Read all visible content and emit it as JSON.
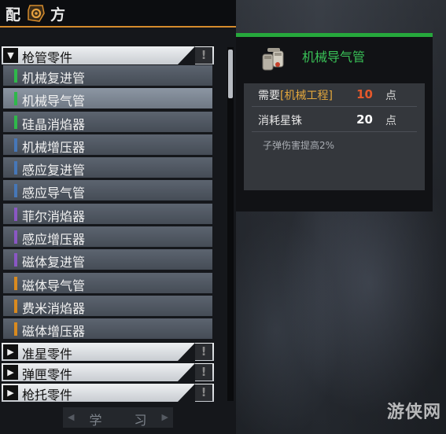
{
  "header": {
    "title_left": "配",
    "title_right": "方",
    "icon": "gear-hex-icon",
    "accent": "#d58b2c"
  },
  "categories": [
    {
      "label": "枪管零件",
      "expanded": true
    },
    {
      "label": "准星零件",
      "expanded": false
    },
    {
      "label": "弹匣零件",
      "expanded": false
    },
    {
      "label": "枪托零件",
      "expanded": false
    }
  ],
  "category_badge": "!",
  "items": [
    {
      "label": "机械复进管",
      "color": "#2fb84a"
    },
    {
      "label": "机械导气管",
      "color": "#2fb84a",
      "selected": true
    },
    {
      "label": "硅晶消焰器",
      "color": "#2fb84a"
    },
    {
      "label": "机械增压器",
      "color": "#4677b8"
    },
    {
      "label": "感应复进管",
      "color": "#4677b8"
    },
    {
      "label": "感应导气管",
      "color": "#4677b8"
    },
    {
      "label": "菲尔消焰器",
      "color": "#8a57c4"
    },
    {
      "label": "感应增压器",
      "color": "#8a57c4"
    },
    {
      "label": "磁体复进管",
      "color": "#8a57c4"
    },
    {
      "label": "磁体导气管",
      "color": "#d98a1f"
    },
    {
      "label": "费米消焰器",
      "color": "#d98a1f"
    },
    {
      "label": "磁体增压器",
      "color": "#d98a1f"
    }
  ],
  "learn_button": "学 习",
  "detail": {
    "title": "机械导气管",
    "icon": "gas-tube-icon",
    "req_prefix": "需要",
    "req_tag": "[机械工程]",
    "req_value": "10",
    "req_value_color": "#e5582b",
    "cost_label": "消耗星铢",
    "cost_value": "20",
    "cost_value_color": "#ffffff",
    "unit": "点",
    "description": "子弹伤害提高2%"
  },
  "watermark": "游侠网"
}
